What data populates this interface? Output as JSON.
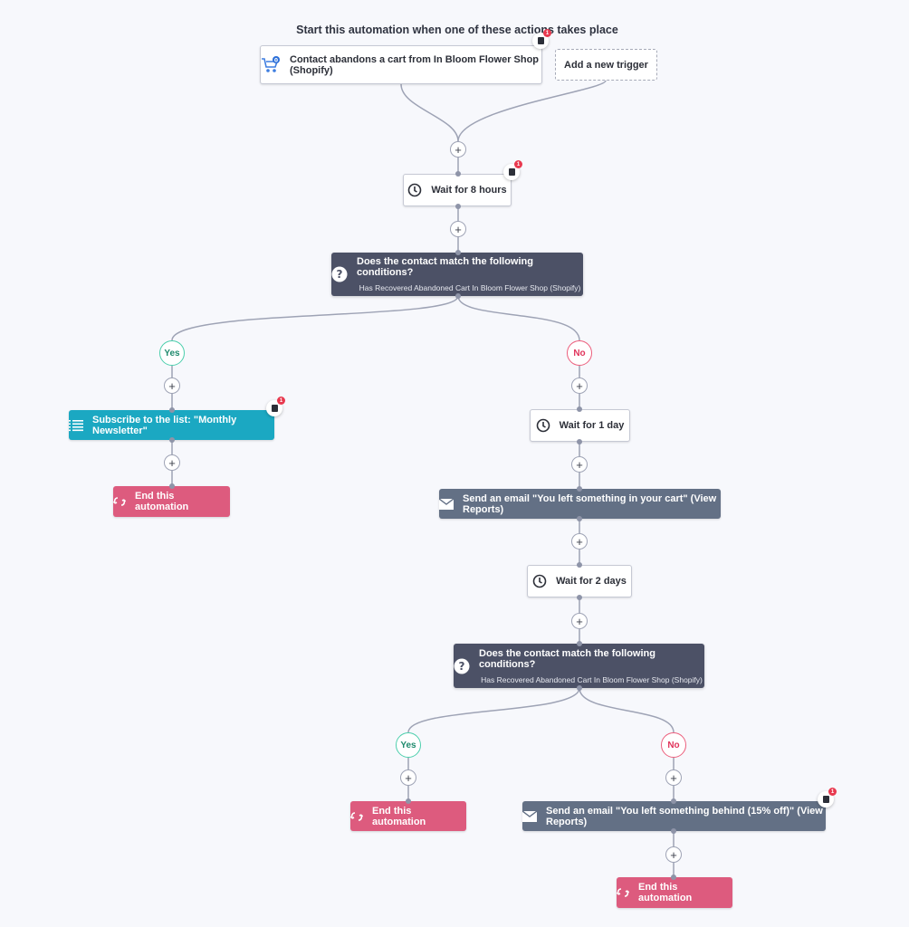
{
  "header": {
    "title": "Start this automation when one of these actions takes place"
  },
  "triggers": {
    "main": {
      "label": "Contact abandons a cart from In Bloom Flower Shop (Shopify)",
      "icon": "shopping-cart-icon",
      "icon_badge": "0",
      "notes_count": "1"
    },
    "add": {
      "label": "Add a new trigger"
    }
  },
  "steps": {
    "wait1": {
      "label": "Wait for 8 hours",
      "icon": "clock-icon",
      "notes_count": "1"
    },
    "cond1": {
      "title": "Does the contact match the following conditions?",
      "subtitle": "Has Recovered Abandoned Cart In Bloom Flower Shop (Shopify)",
      "icon": "question-icon"
    },
    "yes1": {
      "label": "Yes"
    },
    "no1": {
      "label": "No"
    },
    "subscribe": {
      "label": "Subscribe to the list: \"Monthly Newsletter\"",
      "icon": "list-icon",
      "notes_count": "1"
    },
    "end1": {
      "label": "End this automation",
      "icon": "end-loop-icon"
    },
    "wait2": {
      "label": "Wait for 1 day",
      "icon": "clock-icon"
    },
    "email1": {
      "label": "Send an email \"You left something in your cart\" (View Reports)",
      "icon": "envelope-icon"
    },
    "wait3": {
      "label": "Wait for 2 days",
      "icon": "clock-icon"
    },
    "cond2": {
      "title": "Does the contact match the following conditions?",
      "subtitle": "Has Recovered Abandoned Cart In Bloom Flower Shop (Shopify)",
      "icon": "question-icon"
    },
    "yes2": {
      "label": "Yes"
    },
    "no2": {
      "label": "No"
    },
    "end2": {
      "label": "End this automation",
      "icon": "end-loop-icon"
    },
    "email2": {
      "label": "Send an email \"You left something behind (15% off)\" (View Reports)",
      "icon": "envelope-icon",
      "notes_count": "1"
    },
    "end3": {
      "label": "End this automation",
      "icon": "end-loop-icon"
    }
  },
  "add_step_symbol": "+",
  "colors": {
    "yes": "#4dcfad",
    "no": "#ec5f7d",
    "condition": "#4c5166",
    "list_action": "#1ba8c2",
    "end_action": "#dd5b7e",
    "email_action": "#637085",
    "background": "#f7f8fc"
  }
}
